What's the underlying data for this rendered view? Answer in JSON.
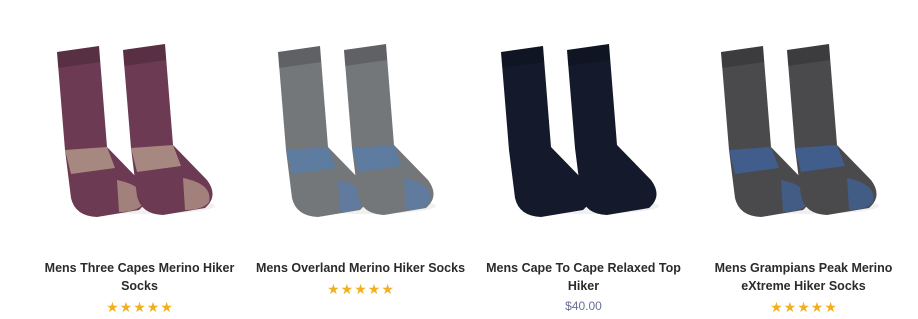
{
  "products": [
    {
      "title": "Mens Three Capes Merino Hiker Socks",
      "rating": 5,
      "price": "",
      "image": "purple-hiker-socks",
      "colors": {
        "main": "#6c3a52",
        "accent": "#d8c8a6"
      }
    },
    {
      "title": "Mens Overland Merino Hiker Socks",
      "rating": 5,
      "price": "",
      "image": "grey-blue-hiker-socks",
      "colors": {
        "main": "#74777a",
        "accent": "#4c7fc0"
      }
    },
    {
      "title": "Mens Cape To Cape Relaxed Top Hiker",
      "rating": 0,
      "price": "$40.00",
      "image": "navy-hiker-socks",
      "colors": {
        "main": "#141a2b",
        "accent": "#141a2b"
      }
    },
    {
      "title": "Mens Grampians Peak Merino eXtreme Hiker Socks",
      "rating": 5,
      "price": "",
      "image": "charcoal-striped-hiker-socks",
      "colors": {
        "main": "#4a4a4c",
        "accent": "#3a6ec0"
      }
    }
  ]
}
